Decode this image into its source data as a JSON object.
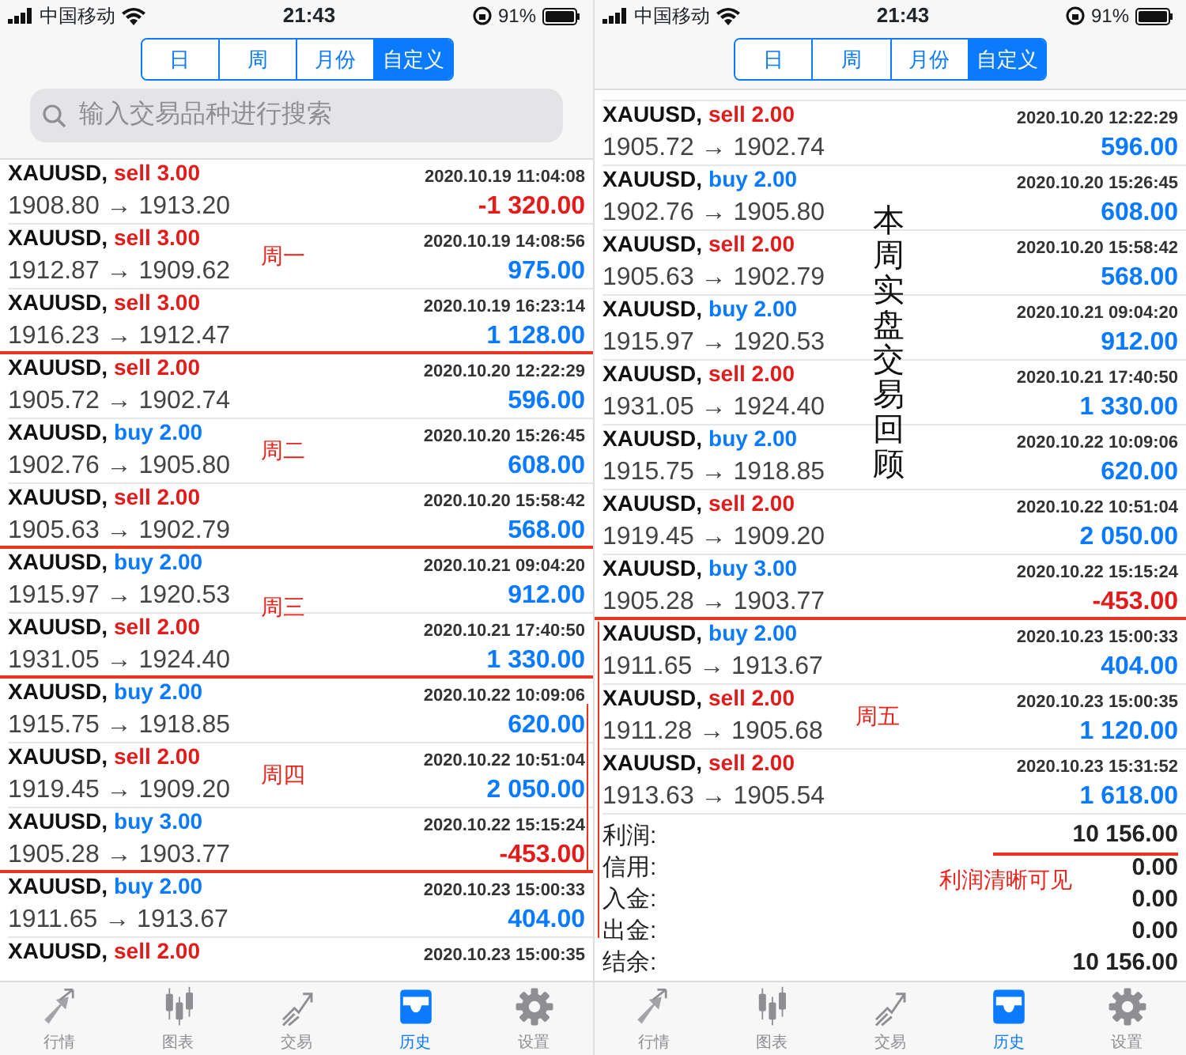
{
  "panels": [
    {
      "status_bar": {
        "carrier": "中国移动",
        "time": "21:43",
        "battery": "91%"
      },
      "segments": [
        {
          "label": "日",
          "selected": false
        },
        {
          "label": "周",
          "selected": false
        },
        {
          "label": "月份",
          "selected": false
        },
        {
          "label": "自定义",
          "selected": true
        }
      ],
      "search": {
        "placeholder": "输入交易品种进行搜索"
      },
      "trades": [
        {
          "symbol": "XAUUSD,",
          "kind": "sell",
          "action": "sell 3.00",
          "time": "2020.10.19 11:04:08",
          "prices": "1908.80 → 1913.20",
          "profit": "-1 320.00",
          "loss": true
        },
        {
          "symbol": "XAUUSD,",
          "kind": "sell",
          "action": "sell 3.00",
          "time": "2020.10.19 14:08:56",
          "prices": "1912.87 → 1909.62",
          "profit": "975.00",
          "loss": false,
          "note": "周一"
        },
        {
          "symbol": "XAUUSD,",
          "kind": "sell",
          "action": "sell 3.00",
          "time": "2020.10.19 16:23:14",
          "prices": "1916.23 → 1912.47",
          "profit": "1 128.00",
          "loss": false,
          "underlined": true
        },
        {
          "symbol": "XAUUSD,",
          "kind": "sell",
          "action": "sell 2.00",
          "time": "2020.10.20 12:22:29",
          "prices": "1905.72 → 1902.74",
          "profit": "596.00",
          "loss": false
        },
        {
          "symbol": "XAUUSD,",
          "kind": "buy",
          "action": "buy 2.00",
          "time": "2020.10.20 15:26:45",
          "prices": "1902.76 → 1905.80",
          "profit": "608.00",
          "loss": false,
          "note": "周二"
        },
        {
          "symbol": "XAUUSD,",
          "kind": "sell",
          "action": "sell 2.00",
          "time": "2020.10.20 15:58:42",
          "prices": "1905.63 → 1902.79",
          "profit": "568.00",
          "loss": false,
          "underlined": true
        },
        {
          "symbol": "XAUUSD,",
          "kind": "buy",
          "action": "buy 2.00",
          "time": "2020.10.21 09:04:20",
          "prices": "1915.97 → 1920.53",
          "profit": "912.00",
          "loss": false,
          "note": "周三"
        },
        {
          "symbol": "XAUUSD,",
          "kind": "sell",
          "action": "sell 2.00",
          "time": "2020.10.21 17:40:50",
          "prices": "1931.05 → 1924.40",
          "profit": "1 330.00",
          "loss": false,
          "underlined": true
        },
        {
          "symbol": "XAUUSD,",
          "kind": "buy",
          "action": "buy 2.00",
          "time": "2020.10.22 10:09:06",
          "prices": "1915.75 → 1918.85",
          "profit": "620.00",
          "loss": false
        },
        {
          "symbol": "XAUUSD,",
          "kind": "sell",
          "action": "sell 2.00",
          "time": "2020.10.22 10:51:04",
          "prices": "1919.45 → 1909.20",
          "profit": "2 050.00",
          "loss": false,
          "note": "周四"
        },
        {
          "symbol": "XAUUSD,",
          "kind": "buy",
          "action": "buy 3.00",
          "time": "2020.10.22 15:15:24",
          "prices": "1905.28 → 1903.77",
          "profit": "-453.00",
          "loss": true,
          "underlined": true
        },
        {
          "symbol": "XAUUSD,",
          "kind": "buy",
          "action": "buy 2.00",
          "time": "2020.10.23 15:00:33",
          "prices": "1911.65 → 1913.67",
          "profit": "404.00",
          "loss": false
        },
        {
          "symbol": "XAUUSD,",
          "kind": "sell",
          "action": "sell 2.00",
          "time": "2020.10.23 15:00:35"
        }
      ],
      "tab_bar": [
        {
          "label": "行情",
          "selected": false
        },
        {
          "label": "图表",
          "selected": false
        },
        {
          "label": "交易",
          "selected": false
        },
        {
          "label": "历史",
          "selected": true
        },
        {
          "label": "设置",
          "selected": false
        }
      ]
    },
    {
      "status_bar": {
        "carrier": "中国移动",
        "time": "21:43",
        "battery": "91%"
      },
      "segments": [
        {
          "label": "日",
          "selected": false
        },
        {
          "label": "周",
          "selected": false
        },
        {
          "label": "月份",
          "selected": false
        },
        {
          "label": "自定义",
          "selected": true
        }
      ],
      "title_note": "本周实盘交易回顾",
      "trades": [
        {
          "symbol": "XAUUSD,",
          "kind": "sell",
          "action": "sell 2.00",
          "time": "2020.10.20 12:22:29",
          "prices": "1905.72 → 1902.74",
          "profit": "596.00",
          "loss": false
        },
        {
          "symbol": "XAUUSD,",
          "kind": "buy",
          "action": "buy 2.00",
          "time": "2020.10.20 15:26:45",
          "prices": "1902.76 → 1905.80",
          "profit": "608.00",
          "loss": false
        },
        {
          "symbol": "XAUUSD,",
          "kind": "sell",
          "action": "sell 2.00",
          "time": "2020.10.20 15:58:42",
          "prices": "1905.63 → 1902.79",
          "profit": "568.00",
          "loss": false
        },
        {
          "symbol": "XAUUSD,",
          "kind": "buy",
          "action": "buy 2.00",
          "time": "2020.10.21 09:04:20",
          "prices": "1915.97 → 1920.53",
          "profit": "912.00",
          "loss": false
        },
        {
          "symbol": "XAUUSD,",
          "kind": "sell",
          "action": "sell 2.00",
          "time": "2020.10.21 17:40:50",
          "prices": "1931.05 → 1924.40",
          "profit": "1 330.00",
          "loss": false
        },
        {
          "symbol": "XAUUSD,",
          "kind": "buy",
          "action": "buy 2.00",
          "time": "2020.10.22 10:09:06",
          "prices": "1915.75 → 1918.85",
          "profit": "620.00",
          "loss": false
        },
        {
          "symbol": "XAUUSD,",
          "kind": "sell",
          "action": "sell 2.00",
          "time": "2020.10.22 10:51:04",
          "prices": "1919.45 → 1909.20",
          "profit": "2 050.00",
          "loss": false
        },
        {
          "symbol": "XAUUSD,",
          "kind": "buy",
          "action": "buy 3.00",
          "time": "2020.10.22 15:15:24",
          "prices": "1905.28 → 1903.77",
          "profit": "-453.00",
          "loss": true,
          "underlined": true
        },
        {
          "symbol": "XAUUSD,",
          "kind": "buy",
          "action": "buy 2.00",
          "time": "2020.10.23 15:00:33",
          "prices": "1911.65 → 1913.67",
          "profit": "404.00",
          "loss": false
        },
        {
          "symbol": "XAUUSD,",
          "kind": "sell",
          "action": "sell 2.00",
          "time": "2020.10.23 15:00:35",
          "prices": "1911.28 → 1905.68",
          "profit": "1 120.00",
          "loss": false,
          "note": "周五"
        },
        {
          "symbol": "XAUUSD,",
          "kind": "sell",
          "action": "sell 2.00",
          "time": "2020.10.23 15:31:52",
          "prices": "1913.63 → 1905.54",
          "profit": "1 618.00",
          "loss": false
        }
      ],
      "summary": [
        {
          "label": "利润:",
          "value": "10 156.00",
          "underlined": true
        },
        {
          "label": "信用:",
          "value": "0.00"
        },
        {
          "label": "入金:",
          "value": "0.00"
        },
        {
          "label": "出金:",
          "value": "0.00"
        },
        {
          "label": "结余:",
          "value": "10 156.00"
        }
      ],
      "summary_note": "利润清晰可见",
      "tab_bar": [
        {
          "label": "行情",
          "selected": false
        },
        {
          "label": "图表",
          "selected": false
        },
        {
          "label": "交易",
          "selected": false
        },
        {
          "label": "历史",
          "selected": true
        },
        {
          "label": "设置",
          "selected": false
        }
      ]
    }
  ]
}
